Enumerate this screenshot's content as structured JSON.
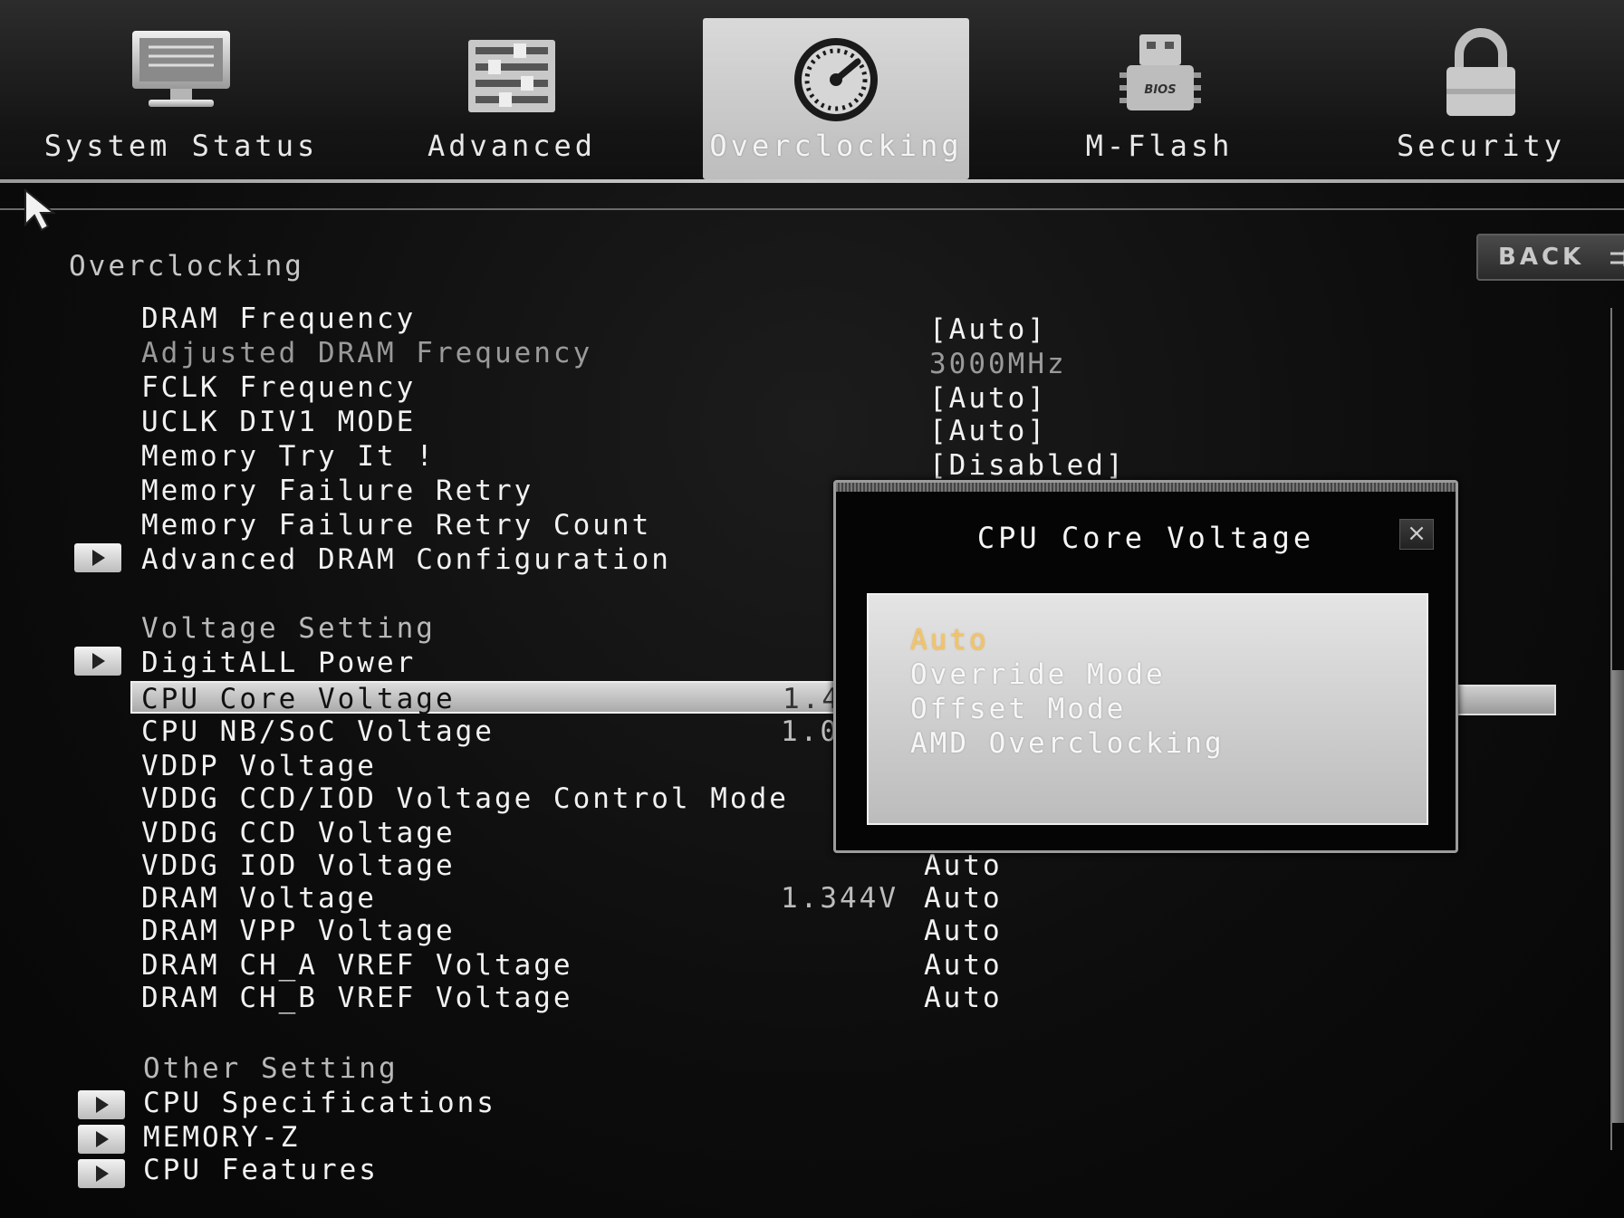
{
  "nav": {
    "tabs": [
      {
        "label": "System Status",
        "icon": "monitor-icon"
      },
      {
        "label": "Advanced",
        "icon": "sliders-icon"
      },
      {
        "label": "Overclocking",
        "icon": "speedometer-icon",
        "active": true
      },
      {
        "label": "M-Flash",
        "icon": "bios-chip-icon"
      },
      {
        "label": "Security",
        "icon": "padlock-icon"
      }
    ],
    "back_label": "BACK"
  },
  "section": {
    "title": "Overclocking",
    "voltage_heading": "Voltage Setting",
    "other_heading": "Other Setting"
  },
  "rows": [
    {
      "label": "DRAM Frequency",
      "value": "[Auto]"
    },
    {
      "label": "Adjusted DRAM Frequency",
      "value": "3000MHz"
    },
    {
      "label": "FCLK Frequency",
      "value": "[Auto]"
    },
    {
      "label": "UCLK DIV1 MODE",
      "value": "[Auto]"
    },
    {
      "label": "Memory Try It !",
      "value": "[Disabled]"
    },
    {
      "label": "Memory Failure Retry",
      "value": ""
    },
    {
      "label": "Memory Failure Retry Count",
      "value": ""
    },
    {
      "label": "Advanced DRAM Configuration",
      "value": ""
    }
  ],
  "voltage_rows": [
    {
      "label": "DigitALL Power",
      "current": "",
      "value": ""
    },
    {
      "label": "CPU Core Voltage",
      "current": "1.4",
      "value": ""
    },
    {
      "label": "CPU NB/SoC Voltage",
      "current": "1.0",
      "value": ""
    },
    {
      "label": "VDDP Voltage",
      "current": "",
      "value": ""
    },
    {
      "label": "VDDG CCD/IOD Voltage Control Mode",
      "current": "",
      "value": ""
    },
    {
      "label": "VDDG CCD Voltage",
      "current": "",
      "value": ""
    },
    {
      "label": "VDDG IOD Voltage",
      "current": "",
      "value": "Auto"
    },
    {
      "label": "DRAM Voltage",
      "current": "1.344V",
      "value": "Auto"
    },
    {
      "label": "DRAM VPP Voltage",
      "current": "",
      "value": "Auto"
    },
    {
      "label": "DRAM CH_A VREF Voltage",
      "current": "",
      "value": "Auto"
    },
    {
      "label": "DRAM CH_B VREF Voltage",
      "current": "",
      "value": "Auto"
    }
  ],
  "other_rows": [
    {
      "label": "CPU Specifications"
    },
    {
      "label": "MEMORY-Z"
    },
    {
      "label": "CPU Features"
    }
  ],
  "modal": {
    "title": "CPU Core Voltage",
    "close_label": "×",
    "options": [
      "Auto",
      "Override Mode",
      "Offset Mode",
      "AMD Overclocking"
    ],
    "current_option": "Auto"
  },
  "colors": {
    "highlight_option": "#f1c46a",
    "background": "#0b0b0b",
    "selection_bar": "#cfcfcf"
  }
}
